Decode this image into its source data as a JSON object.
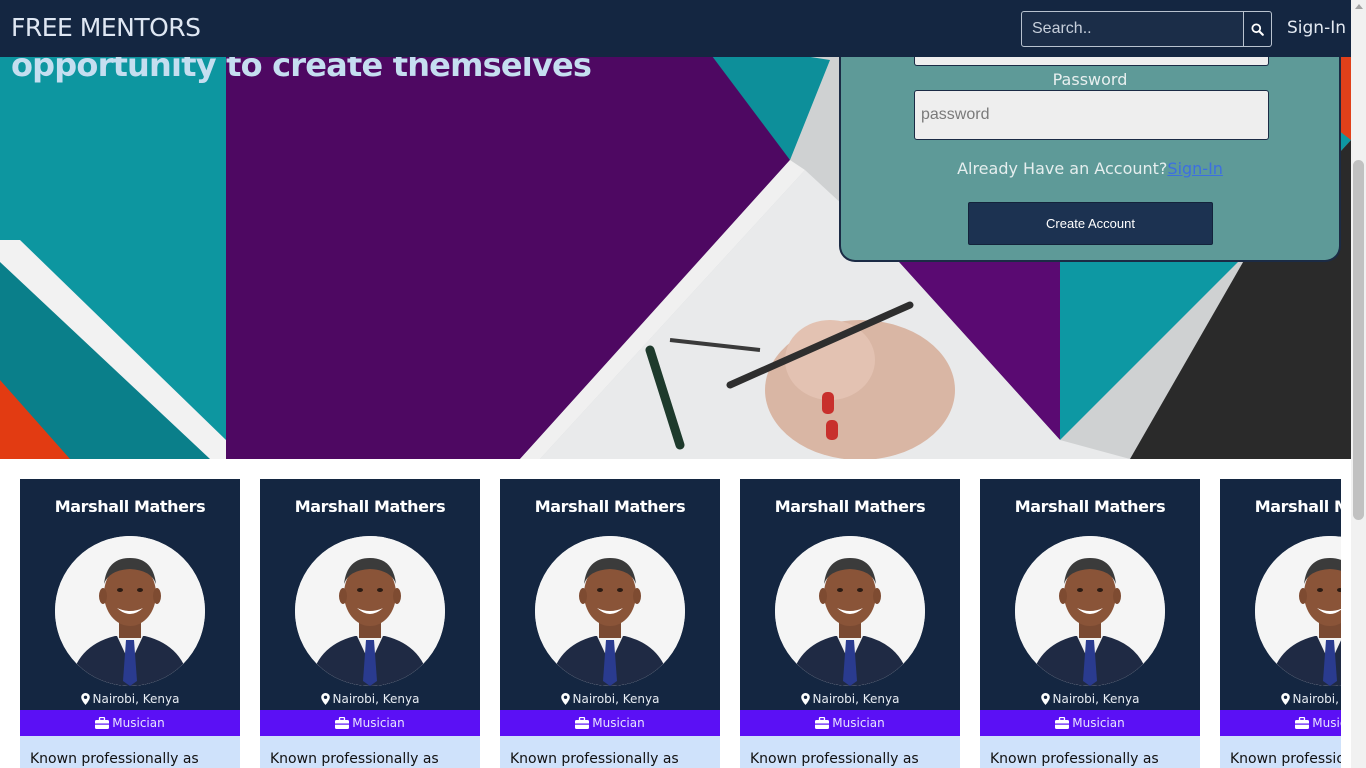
{
  "navbar": {
    "brand": "FREE MENTORS",
    "search_placeholder": "Search..",
    "signin_label": "Sign-In"
  },
  "hero": {
    "tagline": "opportunity to create themselves"
  },
  "signup_form": {
    "password_label": "Password",
    "password_placeholder": "password",
    "already_text": "Already Have an Account?",
    "signin_link": "Sign-In",
    "create_button": "Create Account"
  },
  "mentors": [
    {
      "name": "Marshall Mathers",
      "location": "Nairobi, Kenya",
      "profession": "Musician",
      "bio": "Known professionally as"
    },
    {
      "name": "Marshall Mathers",
      "location": "Nairobi, Kenya",
      "profession": "Musician",
      "bio": "Known professionally as"
    },
    {
      "name": "Marshall Mathers",
      "location": "Nairobi, Kenya",
      "profession": "Musician",
      "bio": "Known professionally as"
    },
    {
      "name": "Marshall Mathers",
      "location": "Nairobi, Kenya",
      "profession": "Musician",
      "bio": "Known professionally as"
    },
    {
      "name": "Marshall Mathers",
      "location": "Nairobi, Kenya",
      "profession": "Musician",
      "bio": "Known professionally as"
    },
    {
      "name": "Marshall Mathers",
      "location": "Nairobi, Kenya",
      "profession": "Musician",
      "bio": "Known professionally as"
    }
  ],
  "icons": {
    "search": "search-icon",
    "location": "map-marker-icon",
    "profession": "briefcase-icon"
  },
  "colors": {
    "navbar": "#142641",
    "form_panel": "#5e9a98",
    "card_top": "#142641",
    "profession_band": "#5b10f5",
    "card_bottom": "#cfe2fb",
    "link": "#3d6fe0"
  }
}
